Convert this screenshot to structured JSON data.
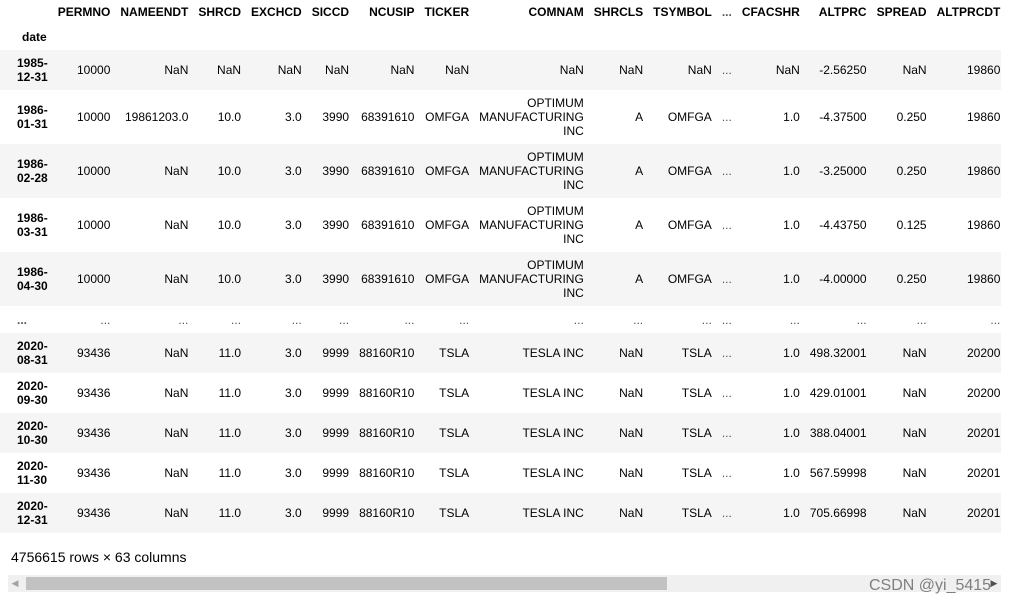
{
  "table": {
    "index_name": "date",
    "columns": [
      "PERMNO",
      "NAMEENDT",
      "SHRCD",
      "EXCHCD",
      "SICCD",
      "NCUSIP",
      "TICKER",
      "COMNAM",
      "SHRCLS",
      "TSYMBOL",
      "...",
      "CFACSHR",
      "ALTPRC",
      "SPREAD",
      "ALTPRCDT"
    ],
    "rows": [
      {
        "date": "1985-12-31",
        "cells": [
          "10000",
          "NaN",
          "NaN",
          "NaN",
          "NaN",
          "NaN",
          "NaN",
          "NaN",
          "NaN",
          "NaN",
          "...",
          "NaN",
          "-2.56250",
          "NaN",
          "19860"
        ]
      },
      {
        "date": "1986-01-31",
        "cells": [
          "10000",
          "19861203.0",
          "10.0",
          "3.0",
          "3990",
          "68391610",
          "OMFGA",
          "OPTIMUM MANUFACTURING INC",
          "A",
          "OMFGA",
          "...",
          "1.0",
          "-4.37500",
          "0.250",
          "19860"
        ]
      },
      {
        "date": "1986-02-28",
        "cells": [
          "10000",
          "NaN",
          "10.0",
          "3.0",
          "3990",
          "68391610",
          "OMFGA",
          "OPTIMUM MANUFACTURING INC",
          "A",
          "OMFGA",
          "...",
          "1.0",
          "-3.25000",
          "0.250",
          "19860"
        ]
      },
      {
        "date": "1986-03-31",
        "cells": [
          "10000",
          "NaN",
          "10.0",
          "3.0",
          "3990",
          "68391610",
          "OMFGA",
          "OPTIMUM MANUFACTURING INC",
          "A",
          "OMFGA",
          "...",
          "1.0",
          "-4.43750",
          "0.125",
          "19860"
        ]
      },
      {
        "date": "1986-04-30",
        "cells": [
          "10000",
          "NaN",
          "10.0",
          "3.0",
          "3990",
          "68391610",
          "OMFGA",
          "OPTIMUM MANUFACTURING INC",
          "A",
          "OMFGA",
          "...",
          "1.0",
          "-4.00000",
          "0.250",
          "19860"
        ]
      },
      {
        "date": "...",
        "cells": [
          "...",
          "...",
          "...",
          "...",
          "...",
          "...",
          "...",
          "...",
          "...",
          "...",
          "...",
          "...",
          "...",
          "...",
          "..."
        ]
      },
      {
        "date": "2020-08-31",
        "cells": [
          "93436",
          "NaN",
          "11.0",
          "3.0",
          "9999",
          "88160R10",
          "TSLA",
          "TESLA INC",
          "NaN",
          "TSLA",
          "...",
          "1.0",
          "498.32001",
          "NaN",
          "20200"
        ]
      },
      {
        "date": "2020-09-30",
        "cells": [
          "93436",
          "NaN",
          "11.0",
          "3.0",
          "9999",
          "88160R10",
          "TSLA",
          "TESLA INC",
          "NaN",
          "TSLA",
          "...",
          "1.0",
          "429.01001",
          "NaN",
          "20200"
        ]
      },
      {
        "date": "2020-10-30",
        "cells": [
          "93436",
          "NaN",
          "11.0",
          "3.0",
          "9999",
          "88160R10",
          "TSLA",
          "TESLA INC",
          "NaN",
          "TSLA",
          "...",
          "1.0",
          "388.04001",
          "NaN",
          "20201"
        ]
      },
      {
        "date": "2020-11-30",
        "cells": [
          "93436",
          "NaN",
          "11.0",
          "3.0",
          "9999",
          "88160R10",
          "TSLA",
          "TESLA INC",
          "NaN",
          "TSLA",
          "...",
          "1.0",
          "567.59998",
          "NaN",
          "20201"
        ]
      },
      {
        "date": "2020-12-31",
        "cells": [
          "93436",
          "NaN",
          "11.0",
          "3.0",
          "9999",
          "88160R10",
          "TSLA",
          "TESLA INC",
          "NaN",
          "TSLA",
          "...",
          "1.0",
          "705.66998",
          "NaN",
          "20201"
        ]
      }
    ]
  },
  "footer": {
    "shape_text": "4756615 rows × 63 columns"
  },
  "scrollbar": {
    "left_arrow": "◀",
    "right_arrow": "▶",
    "position_fraction": 0.0,
    "visible_fraction": 0.67
  },
  "watermark": "CSDN @yi_5415",
  "colors": {
    "row_stripe": "#f5f5f5",
    "scroll_track": "#f0f0f0",
    "scroll_thumb": "#c2c2c2"
  }
}
